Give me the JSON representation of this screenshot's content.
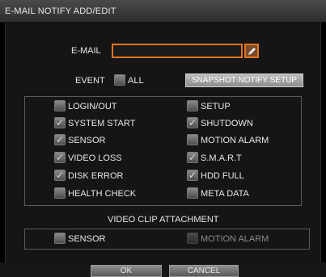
{
  "window": {
    "title": "E-MAIL NOTIFY ADD/EDIT"
  },
  "email": {
    "label": "E-MAIL",
    "value": ""
  },
  "event": {
    "label": "EVENT",
    "all_label": "ALL",
    "all_checked": false,
    "snapshot_button": "SNAPSHOT NOTIFY SETUP"
  },
  "events": [
    {
      "label": "LOGIN/OUT",
      "checked": false
    },
    {
      "label": "SETUP",
      "checked": false
    },
    {
      "label": "SYSTEM START",
      "checked": true
    },
    {
      "label": "SHUTDOWN",
      "checked": true
    },
    {
      "label": "SENSOR",
      "checked": true
    },
    {
      "label": "MOTION ALARM",
      "checked": false
    },
    {
      "label": "VIDEO LOSS",
      "checked": true
    },
    {
      "label": "S.M.A.R.T",
      "checked": true
    },
    {
      "label": "DISK ERROR",
      "checked": true
    },
    {
      "label": "HDD FULL",
      "checked": true
    },
    {
      "label": "HEALTH CHECK",
      "checked": false
    },
    {
      "label": "META DATA",
      "checked": false
    }
  ],
  "video_clip": {
    "title": "VIDEO CLIP ATTACHMENT",
    "sensor": {
      "label": "SENSOR",
      "checked": false
    },
    "motion_alarm": {
      "label": "MOTION ALARM",
      "checked": false,
      "disabled": true
    }
  },
  "footer": {
    "ok_label": "OK",
    "cancel_label": "CANCEL"
  },
  "colors": {
    "accent": "#e4751f"
  },
  "icons": {
    "keyboard_button": "pencil-keyboard-icon",
    "checkmark": "checkmark-icon"
  }
}
